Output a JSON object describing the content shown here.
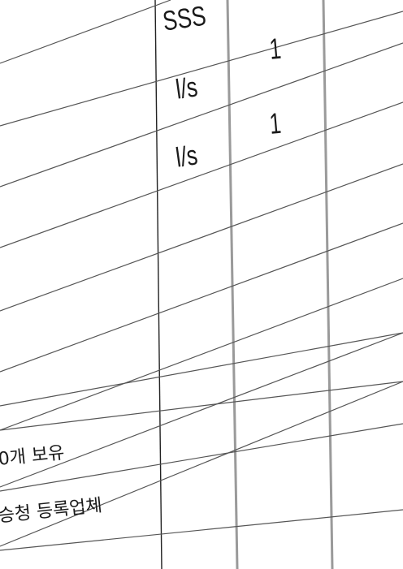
{
  "table": {
    "rows": [
      {
        "unit": "SSS",
        "qty": ""
      },
      {
        "unit": "l/s",
        "qty": "1"
      },
      {
        "unit": "l/s",
        "qty": "1"
      }
    ],
    "notes": [
      "0개 보유",
      "승청 등록업체"
    ]
  },
  "colors": {
    "grid_dark": "#222222",
    "grid_gray": "#9a9a9a"
  }
}
